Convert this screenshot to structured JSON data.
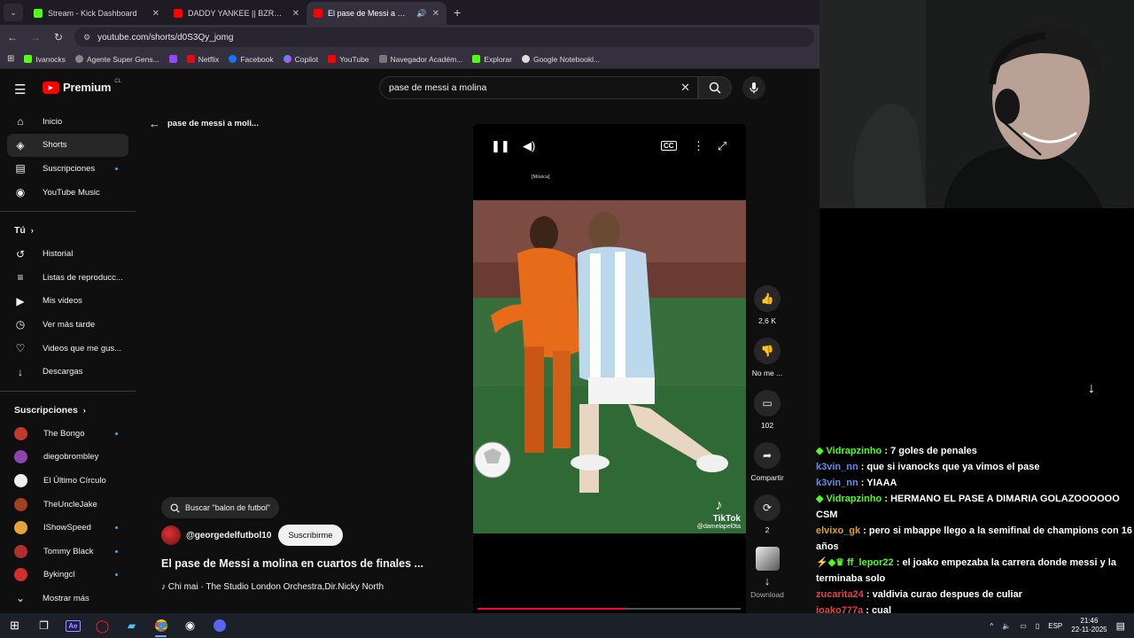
{
  "browser": {
    "tabs": [
      {
        "title": "Stream - Kick Dashboard",
        "color": "#53fc18",
        "active": false
      },
      {
        "title": "DADDY YANKEE || BZRP Music Se",
        "color": "#ff0000",
        "active": false
      },
      {
        "title": "El pase de Messi a molina e",
        "color": "#ff0000",
        "active": true
      }
    ],
    "url": "youtube.com/shorts/d0S3Qy_jomg",
    "bookmarks": [
      "Ivanocks",
      "Agente Super Gens...",
      "",
      "Netflix",
      "Facebook",
      "Copilot",
      "YouTube",
      "Navegador Académ...",
      "Explorar",
      "Google Notebookl..."
    ]
  },
  "header": {
    "logo_text": "Premium",
    "logo_region": "CL",
    "search_value": "pase de messi a molina"
  },
  "sidebar": {
    "main": [
      {
        "label": "Inicio",
        "icon": "home-icon",
        "glyph": "⌂"
      },
      {
        "label": "Shorts",
        "icon": "shorts-icon",
        "glyph": "◈",
        "active": true
      },
      {
        "label": "Suscripciones",
        "icon": "subscriptions-icon",
        "glyph": "▤",
        "dot": true
      },
      {
        "label": "YouTube Music",
        "icon": "youtube-music-icon",
        "glyph": "◉"
      }
    ],
    "you_title": "Tú",
    "you": [
      {
        "label": "Historial",
        "icon": "history-icon",
        "glyph": "↺"
      },
      {
        "label": "Listas de reproducc...",
        "icon": "playlists-icon",
        "glyph": "≡"
      },
      {
        "label": "Mis videos",
        "icon": "my-videos-icon",
        "glyph": "▶"
      },
      {
        "label": "Ver más tarde",
        "icon": "watch-later-icon",
        "glyph": "◷"
      },
      {
        "label": "Videos que me gus...",
        "icon": "liked-videos-icon",
        "glyph": "👍"
      },
      {
        "label": "Descargas",
        "icon": "downloads-icon",
        "glyph": "↓"
      }
    ],
    "subs_title": "Suscripciones",
    "subs": [
      {
        "label": "The Bongo",
        "color": "#c0392b",
        "dot": true
      },
      {
        "label": "diegobrombley",
        "color": "#8e44ad",
        "dot": false
      },
      {
        "label": "El Último Círculo",
        "color": "#eeeeee",
        "dot": false
      },
      {
        "label": "TheUncleJake",
        "color": "#a04020",
        "dot": false
      },
      {
        "label": "IShowSpeed",
        "color": "#e6a23c",
        "dot": true
      },
      {
        "label": "Tommy Black",
        "color": "#b03030",
        "dot": true
      },
      {
        "label": "Bykingcl",
        "color": "#d03030",
        "dot": true
      }
    ],
    "show_more": "Mostrar más"
  },
  "shorts": {
    "back_label": "pase de messi a moli...",
    "search_chip": "Buscar \"balon de futbol\"",
    "channel": "@georgedelfutbol10",
    "subscribe": "Suscribirme",
    "title": "El pase de Messi a molina en cuartos de finales ...",
    "music": "Chi mai · The Studio London Orchestra,Dir.Nicky North",
    "caption_tag": "[Música]",
    "watermark_brand": "TikTok",
    "watermark_user": "@damelapel0ta",
    "progress": 0.56
  },
  "actions": {
    "likes": "2,6 K",
    "dislike": "No me ...",
    "comments": "102",
    "share": "Compartir",
    "remix": "2",
    "download": "Download"
  },
  "chat": [
    {
      "user": "Vidrapzinho",
      "color": "#53fc18",
      "badge": "◆",
      "text": ": 7 goles de penales"
    },
    {
      "user": "k3vin_nn",
      "color": "#5d8ee8",
      "badge": "",
      "text": ": que si ivanocks que ya vimos el pase"
    },
    {
      "user": "k3vin_nn",
      "color": "#5d8ee8",
      "badge": "",
      "text": ": YIAAA"
    },
    {
      "user": "Vidrapzinho",
      "color": "#53fc18",
      "badge": "◆",
      "text": ": HERMANO EL PASE A DIMARIA GOLAZOOOOOO CSM"
    },
    {
      "user": "elvixo_gk",
      "color": "#e0a030",
      "badge": "",
      "text": ": pero si mbappe llego a la semifinal de champions con 16 años"
    },
    {
      "user": "ff_lepor22",
      "color": "#53fc18",
      "badge": "⚡◆♛",
      "text": ": el joako empezaba la carrera donde messi y la terminaba solo"
    },
    {
      "user": "zucarita24",
      "color": "#e0453a",
      "badge": "",
      "text": ": valdivia curao despues de culiar"
    },
    {
      "user": "joako777a",
      "color": "#e0453a",
      "badge": "",
      "text": ": cual"
    }
  ],
  "taskbar": {
    "lang": "ESP",
    "time": "21:46",
    "date": "22-11-2025"
  }
}
